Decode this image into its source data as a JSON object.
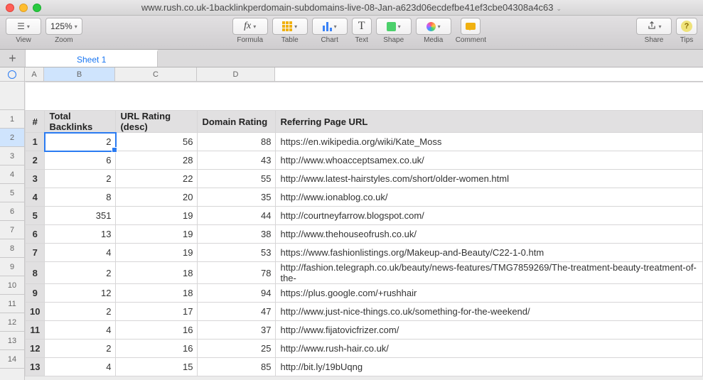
{
  "window_title": "www.rush.co.uk-1backlinkperdomain-subdomains-live-08-Jan-a623d06ecdefbe41ef3cbe04308a4c63",
  "toolbar": {
    "view_label": "View",
    "zoom_label": "Zoom",
    "zoom_value": "125%",
    "formula_label": "Formula",
    "table_label": "Table",
    "chart_label": "Chart",
    "text_label": "Text",
    "shape_label": "Shape",
    "media_label": "Media",
    "comment_label": "Comment",
    "share_label": "Share",
    "tips_label": "Tips"
  },
  "sheet_tab": "Sheet 1",
  "col_letters": [
    "A",
    "B",
    "C",
    "D"
  ],
  "selected_col_idx": 1,
  "selected_row_idx": 2,
  "row_numbers": [
    1,
    2,
    3,
    4,
    5,
    6,
    7,
    8,
    9,
    10,
    11,
    12,
    13,
    14
  ],
  "headers": [
    "#",
    "Total Backlinks",
    "URL Rating (desc)",
    "Domain Rating",
    "Referring Page URL"
  ],
  "rows": [
    {
      "n": 1,
      "tb": 2,
      "ur": 56,
      "dr": 88,
      "url": "https://en.wikipedia.org/wiki/Kate_Moss"
    },
    {
      "n": 2,
      "tb": 6,
      "ur": 28,
      "dr": 43,
      "url": "http://www.whoacceptsamex.co.uk/"
    },
    {
      "n": 3,
      "tb": 2,
      "ur": 22,
      "dr": 55,
      "url": "http://www.latest-hairstyles.com/short/older-women.html"
    },
    {
      "n": 4,
      "tb": 8,
      "ur": 20,
      "dr": 35,
      "url": "http://www.ionablog.co.uk/"
    },
    {
      "n": 5,
      "tb": 351,
      "ur": 19,
      "dr": 44,
      "url": "http://courtneyfarrow.blogspot.com/"
    },
    {
      "n": 6,
      "tb": 13,
      "ur": 19,
      "dr": 38,
      "url": "http://www.thehouseofrush.co.uk/"
    },
    {
      "n": 7,
      "tb": 4,
      "ur": 19,
      "dr": 53,
      "url": "https://www.fashionlistings.org/Makeup-and-Beauty/C22-1-0.htm"
    },
    {
      "n": 8,
      "tb": 2,
      "ur": 18,
      "dr": 78,
      "url": "http://fashion.telegraph.co.uk/beauty/news-features/TMG7859269/The-treatment-beauty-treatment-of-the-"
    },
    {
      "n": 9,
      "tb": 12,
      "ur": 18,
      "dr": 94,
      "url": "https://plus.google.com/+rushhair"
    },
    {
      "n": 10,
      "tb": 2,
      "ur": 17,
      "dr": 47,
      "url": "http://www.just-nice-things.co.uk/something-for-the-weekend/"
    },
    {
      "n": 11,
      "tb": 4,
      "ur": 16,
      "dr": 37,
      "url": "http://www.fijatovicfrizer.com/"
    },
    {
      "n": 12,
      "tb": 2,
      "ur": 16,
      "dr": 25,
      "url": "http://www.rush-hair.co.uk/"
    },
    {
      "n": 13,
      "tb": 4,
      "ur": 15,
      "dr": 85,
      "url": "http://bit.ly/19bUqng"
    }
  ]
}
